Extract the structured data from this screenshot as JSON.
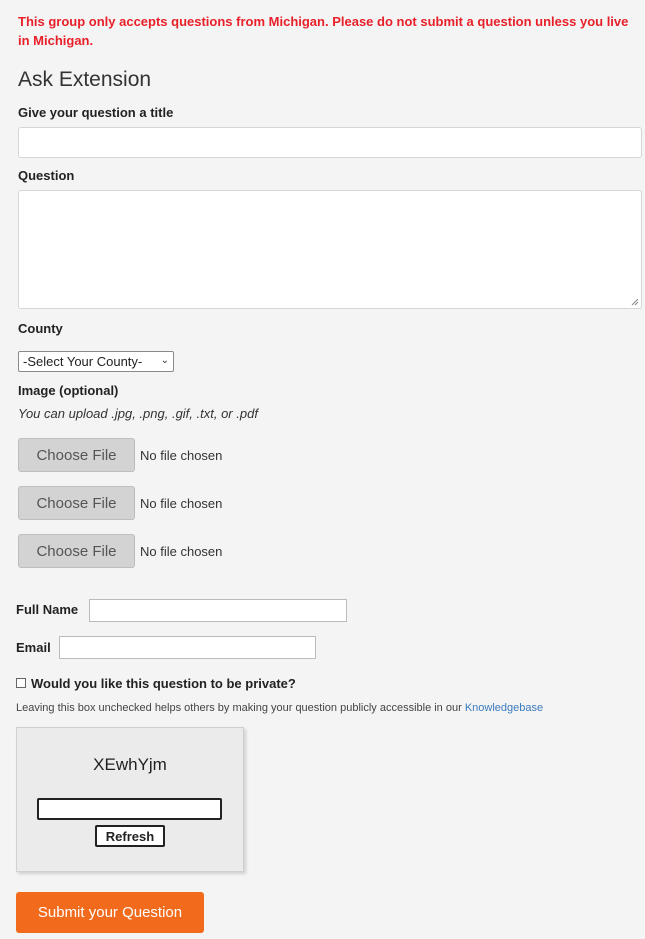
{
  "warning": "This group only accepts questions from Michigan. Please do not submit a question unless you live in Michigan.",
  "form": {
    "heading": "Ask Extension",
    "title_label": "Give your question a title",
    "title_value": "",
    "question_label": "Question",
    "question_value": "",
    "county_label": "County",
    "county_selected": "-Select Your County-",
    "image_label": "Image (optional)",
    "image_hint": "You can upload .jpg, .png, .gif, .txt, or .pdf",
    "files": [
      {
        "button": "Choose File",
        "status": "No file chosen"
      },
      {
        "button": "Choose File",
        "status": "No file chosen"
      },
      {
        "button": "Choose File",
        "status": "No file chosen"
      }
    ],
    "full_name_label": "Full Name",
    "full_name_value": "",
    "email_label": "Email",
    "email_value": "",
    "private_label": "Would you like this question to be private?",
    "private_checked": false,
    "private_note": "Leaving this box unchecked helps others by making your question publicly accessible in our ",
    "knowledgebase_link": "Knowledgebase",
    "captcha_code": "XEwhYjm",
    "captcha_value": "",
    "refresh_label": "Refresh",
    "submit_label": "Submit your Question"
  },
  "colors": {
    "warning": "#e8202a",
    "submit": "#f26b1d",
    "link": "#3a7bbf",
    "background": "#f4f4f4"
  }
}
